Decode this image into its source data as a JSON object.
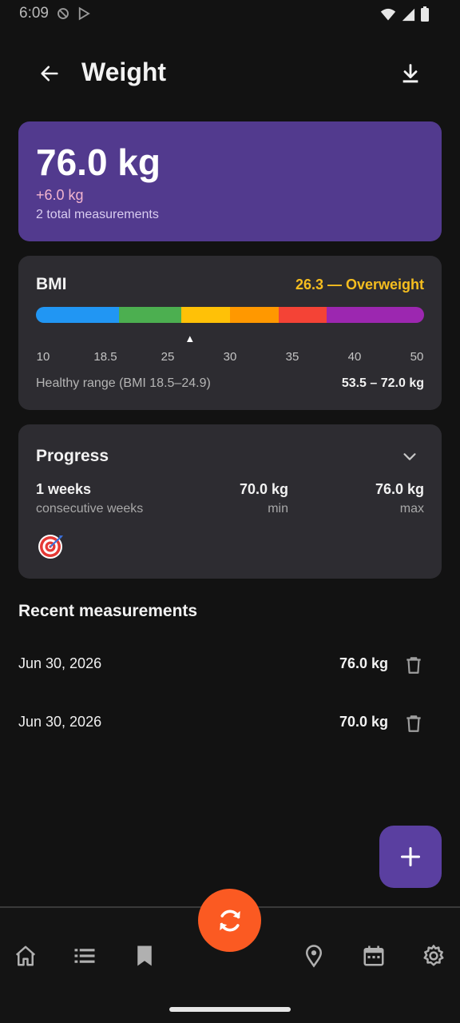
{
  "status_bar": {
    "time": "6:09"
  },
  "header": {
    "title": "Weight"
  },
  "summary": {
    "current_weight": "76.0 kg",
    "change": "+6.0 kg",
    "total_measurements": "2 total measurements"
  },
  "bmi": {
    "title": "BMI",
    "value_text": "26.3 — Overweight",
    "value": 26.3,
    "scale_min": 10,
    "scale_max": 50,
    "ticks": [
      "10",
      "18.5",
      "25",
      "30",
      "35",
      "40",
      "50"
    ],
    "segments": [
      {
        "color": "#2196f3",
        "fraction": 0.215
      },
      {
        "color": "#4caf50",
        "fraction": 0.16
      },
      {
        "color": "#ffc107",
        "fraction": 0.125
      },
      {
        "color": "#ff9800",
        "fraction": 0.125
      },
      {
        "color": "#f44336",
        "fraction": 0.125
      },
      {
        "color": "#9c27b0",
        "fraction": 0.25
      }
    ],
    "marker": "▲",
    "healthy_label": "Healthy range (BMI 18.5–24.9)",
    "healthy_value": "53.5 – 72.0 kg"
  },
  "progress": {
    "title": "Progress",
    "weeks_value": "1 weeks",
    "weeks_label": "consecutive weeks",
    "min_value": "70.0 kg",
    "min_label": "min",
    "max_value": "76.0 kg",
    "max_label": "max"
  },
  "recent": {
    "title": "Recent measurements",
    "items": [
      {
        "date": "Jun 30, 2026",
        "weight": "76.0 kg"
      },
      {
        "date": "Jun 30, 2026",
        "weight": "70.0 kg"
      }
    ]
  },
  "colors": {
    "accent": "#523a8e",
    "fab": "#5a3fa0",
    "sync": "#fb5a22",
    "bmi_text": "#f5bd1f"
  },
  "nav": {
    "items": [
      "home-icon",
      "list-icon",
      "bookmark-icon",
      "location-icon",
      "calendar-icon",
      "settings-icon"
    ]
  }
}
